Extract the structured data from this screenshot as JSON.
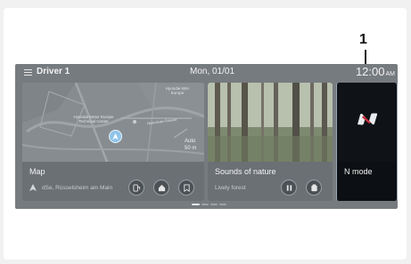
{
  "statusbar": {
    "driver": "Driver 1",
    "date": "Mon, 01/01",
    "time": "12:00",
    "ampm": "AM"
  },
  "map": {
    "title": "Map",
    "address": "dSe, Rüsselsheim am Main",
    "poi_1": "Hyundai Motor Europe Technical Center",
    "poi_2": "Hyundai-WIA Europe",
    "road_label": "Main-Gate-Strasse",
    "auto_label": "Auto",
    "distance": "50 m",
    "buttons": [
      "ev-charging-icon",
      "home-icon",
      "bookmark-icon"
    ]
  },
  "nature": {
    "title": "Sounds of nature",
    "subtitle": "Lively forest",
    "buttons": [
      "pause-icon",
      "sound-list-icon"
    ]
  },
  "nmode": {
    "title": "N mode",
    "logo": "n-logo-icon"
  },
  "callout": {
    "number": "1"
  },
  "colors": {
    "screen_bg": "#767b7f",
    "nmode_bg": "#0f1217",
    "highlight_border": "#9aa6b3",
    "location_marker": "#8fc4ea"
  }
}
